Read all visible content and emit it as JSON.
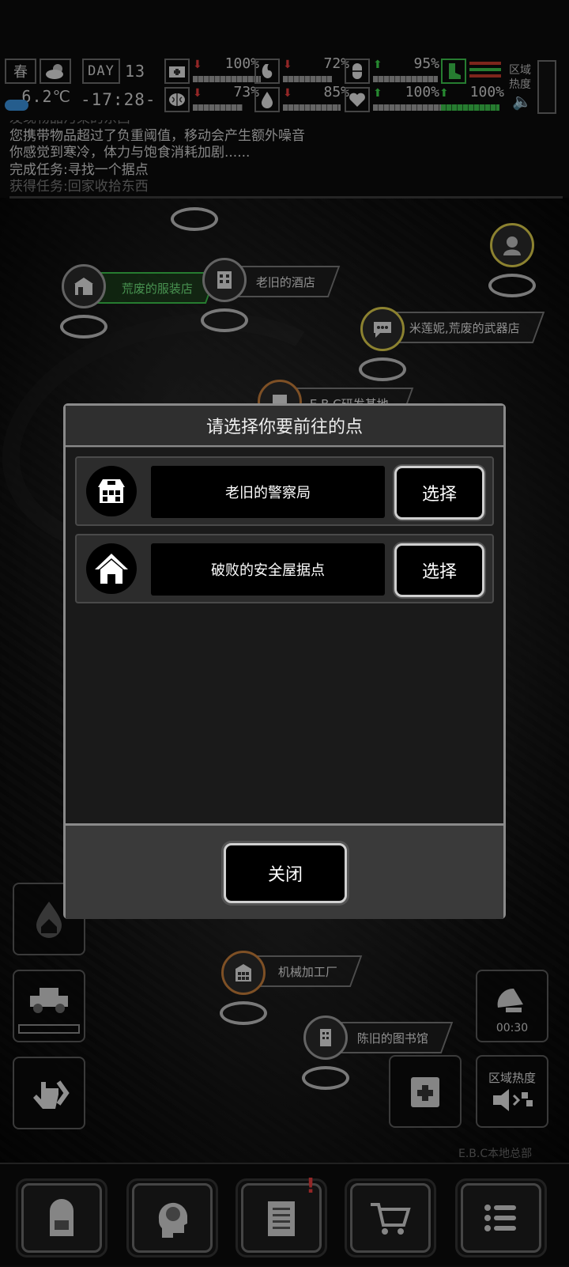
{
  "hud": {
    "season": "春",
    "temperature": "6.2℃",
    "day_label": "DAY",
    "day_number": "13",
    "clock": "-17:28-",
    "stats": [
      {
        "icon": "medkit-icon",
        "trend": "down",
        "value": "100%",
        "level": 1.0
      },
      {
        "icon": "stomach-icon",
        "trend": "down",
        "value": "72%",
        "level": 0.72
      },
      {
        "icon": "pill-icon",
        "trend": "up",
        "value": "95%",
        "level": 0.95
      },
      {
        "icon": "brain-icon",
        "trend": "down",
        "value": "73%",
        "level": 0.73
      },
      {
        "icon": "water-drop-icon",
        "trend": "down",
        "value": "85%",
        "level": 0.85
      },
      {
        "icon": "heart-icon",
        "trend": "up",
        "value": "100%",
        "level": 1.0
      },
      {
        "icon": "boot-icon",
        "trend": "up",
        "value": "100%",
        "level": 1.0
      }
    ],
    "zone_heat_label": "区域热度"
  },
  "log": [
    "发现物品污染的东西",
    "您携带物品超过了负重阈值，移动会产生额外噪音",
    "你感觉到寒冷，体力与饱食消耗加剧......",
    "完成任务:寻找一个据点",
    "获得任务:回家收拾东西"
  ],
  "map_pins": [
    {
      "label": "荒废的服装店",
      "icon": "clothing-store-icon",
      "style": "green"
    },
    {
      "label": "老旧的酒店",
      "icon": "hotel-icon",
      "style": "normal"
    },
    {
      "label": "米莲妮,荒废的武器店",
      "icon": "chat-icon",
      "style": "yellow"
    },
    {
      "label": "E.B.C研发基地",
      "icon": "lab-icon",
      "style": "orange"
    },
    {
      "label": "机械加工厂",
      "icon": "factory-icon",
      "style": "orange"
    },
    {
      "label": "陈旧的图书馆",
      "icon": "library-icon",
      "style": "normal"
    },
    {
      "label": "E.B.C本地总部",
      "icon": "hq-icon",
      "style": "normal"
    }
  ],
  "side_buttons": {
    "timer": "00:30",
    "zone_heat": "区域热度"
  },
  "dialog": {
    "title": "请选择你要前往的点",
    "options": [
      {
        "name": "老旧的警察局",
        "icon": "police-station-icon",
        "button": "选择"
      },
      {
        "name": "破败的安全屋据点",
        "icon": "house-icon",
        "button": "选择"
      }
    ],
    "close_label": "关闭"
  }
}
